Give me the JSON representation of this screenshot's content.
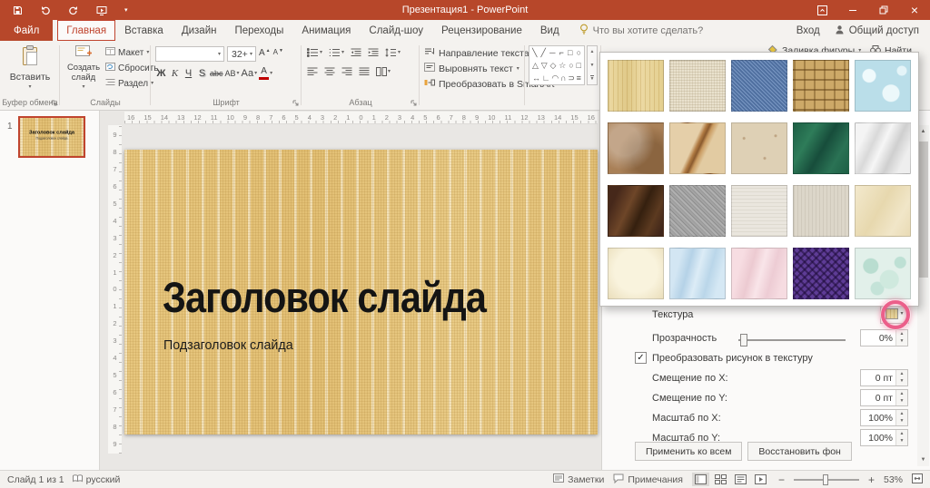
{
  "colors": {
    "titlebar": "#B7472A",
    "accent": "#C0442E",
    "highlight": "#EB5F8A"
  },
  "icons": {
    "caret": "▾",
    "up": "▲",
    "down": "▼",
    "check": "✓",
    "close": "×",
    "minus": "−",
    "plus": "+",
    "letter_A": "А"
  },
  "titlebar": {
    "title": "Презентация1 - PowerPoint"
  },
  "tabs": {
    "file": "Файл",
    "home": "Главная",
    "insert": "Вставка",
    "design": "Дизайн",
    "transitions": "Переходы",
    "animations": "Анимация",
    "slideshow": "Слайд-шоу",
    "review": "Рецензирование",
    "view": "Вид",
    "tell_me": "Что вы хотите сделать?",
    "sign_in": "Вход",
    "share": "Общий доступ"
  },
  "ribbon": {
    "paste_label": "Вставить",
    "clipboard_group_label": "Буфер обмена",
    "new_slide_label": "Создать слайд",
    "layout_label": "Макет",
    "reset_label": "Сбросить",
    "section_label": "Раздел",
    "slides_group_label": "Слайды",
    "font_name_value": "",
    "font_size_value": "32+",
    "bold_label": "Ж",
    "italic_label": "К",
    "underline_label": "Ч",
    "strike_label": "abc",
    "shadow_label": "S",
    "char_spacing_label": "АВ",
    "change_case_label": "Аа",
    "font_color_label": "А",
    "font_group_label": "Шрифт",
    "paragraph_group_label": "Абзац",
    "text_direction_label": "Направление текста",
    "align_text_label": "Выровнять текст",
    "smartart_label": "Преобразовать в SmartArt",
    "shape_fill_label": "Заливка фигуры",
    "find_label": "Найти",
    "shapes_row1": [
      "╲",
      "╱",
      "─",
      "⌐",
      "□",
      "○"
    ],
    "shapes_row2": [
      "△",
      "▽",
      "◇",
      "☆",
      "○",
      "□"
    ],
    "shapes_row3": [
      "↔",
      "∟",
      "◠",
      "∩",
      "⊃",
      "≡"
    ]
  },
  "rulers": {
    "horizontal": [
      "16",
      "15",
      "14",
      "13",
      "12",
      "11",
      "10",
      "9",
      "8",
      "7",
      "6",
      "5",
      "4",
      "3",
      "2",
      "1",
      "0",
      "1",
      "2",
      "3",
      "4",
      "5",
      "6",
      "7",
      "8",
      "9",
      "10",
      "11",
      "12",
      "13",
      "14",
      "15",
      "16"
    ],
    "vertical": [
      "9",
      "8",
      "7",
      "6",
      "5",
      "4",
      "3",
      "2",
      "1",
      "0",
      "1",
      "2",
      "3",
      "4",
      "5",
      "6",
      "7",
      "8",
      "9"
    ]
  },
  "thumbnail_panel": {
    "slide_number": "1"
  },
  "slide": {
    "title": "Заголовок слайда",
    "subtitle": "Подзаголовок слайда",
    "background_style": "background: repeating-linear-gradient(90deg, rgba(163,120,44,0.16) 0 1px, rgba(255,255,255,0) 1px 3px), repeating-linear-gradient(0deg, rgba(163,120,44,0.14) 0 1px, rgba(255,255,255,0) 1px 3px), repeating-linear-gradient(90deg, rgba(255,252,240,0.5) 0 3px, rgba(255,255,255,0) 3px 17px), linear-gradient(90deg, #e7c77f, #e2bf74 40%, #e8ca85 70%, #e3c178)"
  },
  "texture_gallery": {
    "textures": [
      {
        "name": "papyrus",
        "bg": "repeating-linear-gradient(90deg, rgba(170,130,50,0.25) 0 1px, rgba(255,255,255,0) 1px 5px), linear-gradient(90deg, #ecd9a2, #e0c988 35%, #ecd9a2 60%, #e4cf90)"
      },
      {
        "name": "canvas",
        "bg": "repeating-linear-gradient(0deg, rgba(140,120,80,0.18) 0 1px, rgba(255,255,255,0) 1px 3px), repeating-linear-gradient(90deg, rgba(140,120,80,0.14) 0 1px, rgba(255,255,255,0) 1px 3px), #e9e1cd"
      },
      {
        "name": "denim",
        "bg": "repeating-linear-gradient(45deg, rgba(255,255,255,0.18) 0 1px, rgba(0,0,0,0.12) 1px 3px), #5b80b6"
      },
      {
        "name": "woven-mat",
        "bg": "repeating-linear-gradient(0deg, rgba(96,64,20,0.5) 0 2px, rgba(255,255,255,0) 2px 11px), repeating-linear-gradient(90deg, rgba(96,64,20,0.38) 0 2px, rgba(255,255,255,0) 2px 11px), #cda968"
      },
      {
        "name": "water-droplets",
        "bg": "radial-gradient(circle at 25% 30%, #f0fafc 0 7px, rgba(255,255,255,0) 8px), radial-gradient(circle at 65% 65%, #ecf8fa 0 9px, rgba(255,255,255,0) 10px), radial-gradient(circle at 85% 20%, #e4f4f8 0 5px, rgba(255,255,255,0) 6px), #badee9"
      },
      {
        "name": "paper-bag",
        "bg": "radial-gradient(circle at 30% 35%, rgba(255,255,255,0.3) 0 30%, rgba(255,255,255,0) 60%), radial-gradient(circle at 75% 70%, rgba(70,40,10,0.3) 0 30%, rgba(255,255,255,0) 60%), #a98057"
      },
      {
        "name": "fish-fossil",
        "bg": "linear-gradient(115deg, #e5cfa9 42%, #b07a42 48%, #8a5a2e 52%, #c99a60 56%, #e2cba2 64%), #e3cda9"
      },
      {
        "name": "sand",
        "bg": "radial-gradient(circle at 22% 30%, rgba(150,110,70,0.45) 0 1px, rgba(255,255,255,0) 2px), radial-gradient(circle at 60% 70%, rgba(150,110,70,0.45) 0 1px, rgba(255,255,255,0) 2px), radial-gradient(circle at 80% 25%, rgba(150,110,70,0.45) 0 1px, rgba(255,255,255,0) 2px), #ded0b5"
      },
      {
        "name": "green-marble",
        "bg": "linear-gradient(120deg, #1d5f45 0%, #2e7c59 28%, #174d3b 52%, #2a7254 76%, #1d5f45 100%)"
      },
      {
        "name": "white-marble",
        "bg": "linear-gradient(115deg, #f4f4f4 18%, #d9d9d9 34%, #f6f6f6 48%, #cfcfcf 66%, #eeeeee 84%)"
      },
      {
        "name": "brown-marble",
        "bg": "linear-gradient(115deg, #46281a 15%, #6e4628 38%, #35200f 58%, #5c3a20 78%, #40261a 95%)"
      },
      {
        "name": "granite",
        "bg": "repeating-linear-gradient(45deg, #b0b0b0 0 2px, #8e8e8e 2px 3px, #a4a4a4 3px 5px, #979797 5px 6px)"
      },
      {
        "name": "newsprint",
        "bg": "repeating-linear-gradient(0deg, rgba(120,110,90,0.1) 0 1px, rgba(255,255,255,0) 1px 4px), #eae6de"
      },
      {
        "name": "recycled-paper",
        "bg": "repeating-linear-gradient(90deg, rgba(120,110,90,0.12) 0 1px, rgba(255,255,255,0) 1px 4px), #dcd6c9"
      },
      {
        "name": "parchment",
        "bg": "linear-gradient(120deg, #f3e9cd 0%, #e7d8ae 45%, #f1e6c8 75%, #e9dbb5 100%)"
      },
      {
        "name": "stationery",
        "bg": "radial-gradient(ellipse at 50% 45%, #f9f3dd 0 55%, #eadebb 100%)"
      },
      {
        "name": "blue-tissue-paper",
        "bg": "linear-gradient(105deg, #d3e6f3 18%, #b5d2e7 34%, #dcecf6 50%, #bad6e9 68%, #d5e8f4 85%)"
      },
      {
        "name": "pink-tissue-paper",
        "bg": "linear-gradient(105deg, #f7dde2 18%, #eccad1 36%, #f9e5e9 52%, #edccd4 70%, #f6dce1 88%)"
      },
      {
        "name": "purple-mesh",
        "bg": "repeating-linear-gradient(45deg, rgba(25,8,50,0.5) 0 2px, rgba(255,255,255,0) 2px 6px), repeating-linear-gradient(135deg, rgba(25,8,50,0.5) 0 2px, rgba(255,255,255,0) 2px 6px), #5e3c96"
      },
      {
        "name": "bouquet",
        "bg": "radial-gradient(circle at 28% 35%, #b9ddd0 0 8px, rgba(255,255,255,0) 9px), radial-gradient(circle at 62% 62%, #cfe9de 0 10px, rgba(255,255,255,0) 11px), radial-gradient(circle at 82% 28%, #bde0d4 0 6px, rgba(255,255,255,0) 7px), radial-gradient(circle at 40% 80%, #c4e3d8 0 7px, rgba(255,255,255,0) 8px), #e2f0ea"
      }
    ]
  },
  "format_pane": {
    "texture_label": "Текстура",
    "texture_preview_style": "background: repeating-linear-gradient(90deg, rgba(170,130,50,0.3) 0 1px, rgba(255,255,255,0) 1px 4px), #e8d49c",
    "transparency_label": "Прозрачность",
    "transparency_value": "0%",
    "tile_checkbox_label": "Преобразовать рисунок в текстуру",
    "offset_rows": [
      {
        "label": "Смещение по X:",
        "value": "0 пт"
      },
      {
        "label": "Смещение по Y:",
        "value": "0 пт"
      },
      {
        "label": "Масштаб по X:",
        "value": "100%"
      },
      {
        "label": "Масштаб по Y:",
        "value": "100%"
      }
    ],
    "apply_all_label": "Применить ко всем",
    "reset_background_label": "Восстановить фон"
  },
  "annotations": {
    "circle_style": "border-color:#eb5f8a"
  },
  "statusbar": {
    "slide_count": "Слайд 1 из 1",
    "language": "русский",
    "notes_label": "Заметки",
    "comments_label": "Примечания",
    "zoom_value": "53%"
  }
}
